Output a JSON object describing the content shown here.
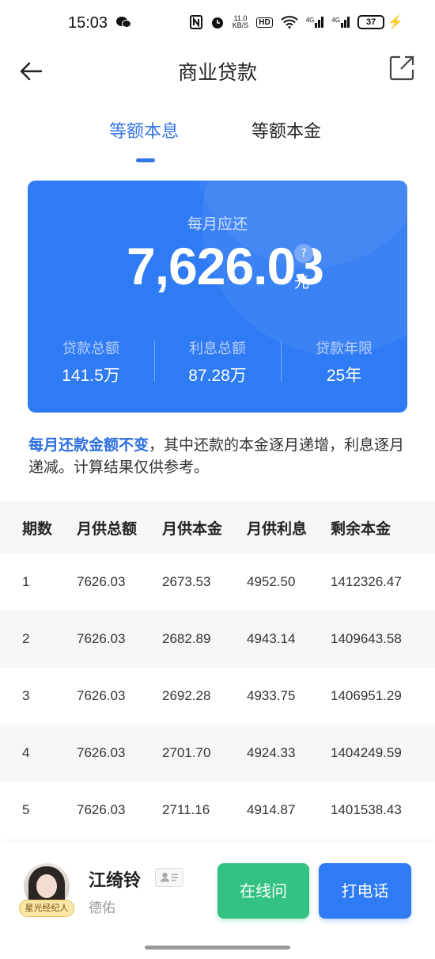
{
  "status": {
    "time": "15:03",
    "speed_top": "11.0",
    "speed_bottom": "KB/S",
    "hd": "HD",
    "net1": "4G",
    "net2": "4G",
    "battery": "37"
  },
  "header": {
    "title": "商业贷款"
  },
  "tabs": [
    {
      "label": "等额本息",
      "active": true
    },
    {
      "label": "等额本金",
      "active": false
    }
  ],
  "summary": {
    "monthly_label": "每月应还",
    "monthly_value": "7,626.03",
    "help": "?",
    "unit": "元",
    "stats": [
      {
        "label": "贷款总额",
        "value": "141.5万"
      },
      {
        "label": "利息总额",
        "value": "87.28万"
      },
      {
        "label": "贷款年限",
        "value": "25年"
      }
    ]
  },
  "note": {
    "highlight": "每月还款金额不变",
    "rest": "，其中还款的本金逐月递增，利息逐月递减。计算结果仅供参考。"
  },
  "table": {
    "headers": [
      "期数",
      "月供总额",
      "月供本金",
      "月供利息",
      "剩余本金"
    ],
    "rows": [
      [
        "1",
        "7626.03",
        "2673.53",
        "4952.50",
        "1412326.47"
      ],
      [
        "2",
        "7626.03",
        "2682.89",
        "4943.14",
        "1409643.58"
      ],
      [
        "3",
        "7626.03",
        "2692.28",
        "4933.75",
        "1406951.29"
      ],
      [
        "4",
        "7626.03",
        "2701.70",
        "4924.33",
        "1404249.59"
      ],
      [
        "5",
        "7626.03",
        "2711.16",
        "4914.87",
        "1401538.43"
      ]
    ]
  },
  "agent": {
    "badge": "星光经纪人",
    "name": "江绮铃",
    "company": "德佑",
    "online_label": "在线问",
    "call_label": "打电话"
  },
  "colors": {
    "accent": "#2f7bf4",
    "green": "#33c283"
  }
}
